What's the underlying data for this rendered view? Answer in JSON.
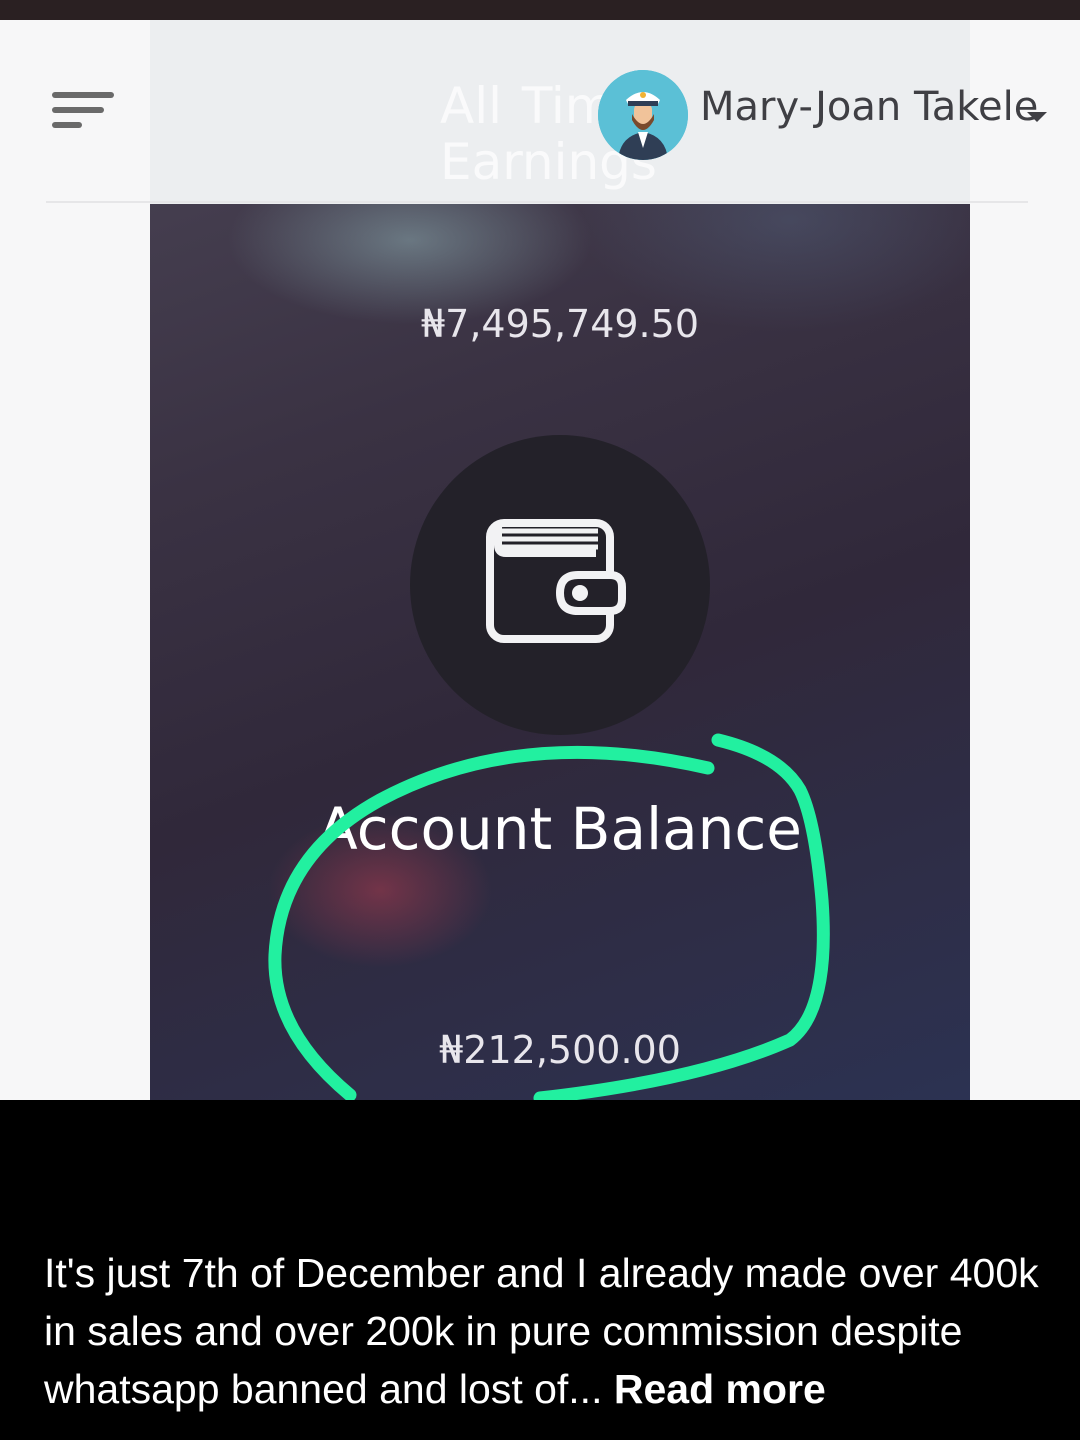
{
  "header": {
    "card_title": "All Time Earnings",
    "user_name": "Mary-Joan Takele"
  },
  "earnings": {
    "value": "₦7,495,749.50"
  },
  "balance": {
    "title": "Account Balance",
    "value": "₦212,500.00"
  },
  "icons": {
    "menu": "hamburger-menu-icon",
    "wallet": "wallet-icon",
    "avatar": "captain-avatar",
    "dropdown": "caret-down-icon"
  },
  "colors": {
    "highlight": "#22f0a0",
    "card_dark": "#30283a"
  },
  "caption": {
    "text": "It's just 7th of December and I already made over 400k in sales and over 200k in pure commission despite whatsapp banned and lost of... ",
    "read_more": "Read more"
  }
}
